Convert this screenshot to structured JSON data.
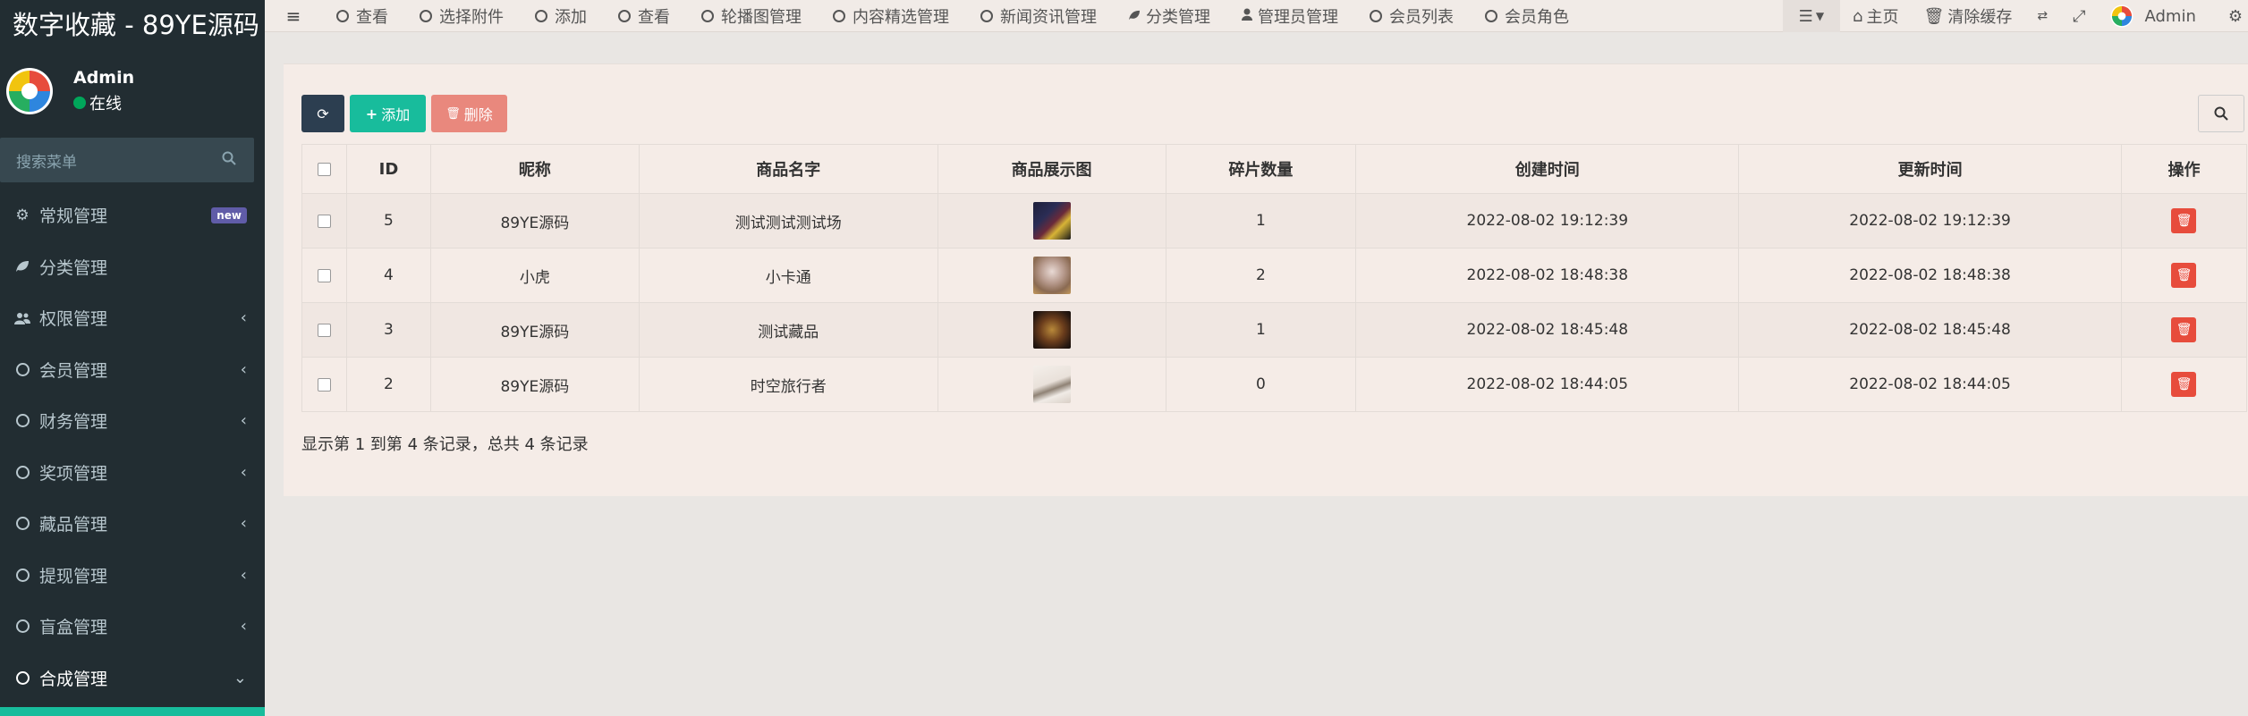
{
  "app_title": "数字收藏 - 89YE源码",
  "user": {
    "name": "Admin",
    "status": "在线"
  },
  "search": {
    "placeholder": "搜索菜单"
  },
  "menu": [
    {
      "label": "常规管理",
      "icon": "cogs-icon",
      "badge": "new"
    },
    {
      "label": "分类管理",
      "icon": "leaf-icon"
    },
    {
      "label": "权限管理",
      "icon": "group-icon",
      "arrow": "‹"
    },
    {
      "label": "会员管理",
      "icon": "circle-o-icon",
      "arrow": "‹"
    },
    {
      "label": "财务管理",
      "icon": "circle-o-icon",
      "arrow": "‹"
    },
    {
      "label": "奖项管理",
      "icon": "circle-o-icon",
      "arrow": "‹"
    },
    {
      "label": "藏品管理",
      "icon": "circle-o-icon",
      "arrow": "‹"
    },
    {
      "label": "提现管理",
      "icon": "circle-o-icon",
      "arrow": "‹"
    },
    {
      "label": "盲盒管理",
      "icon": "circle-o-icon",
      "arrow": "‹"
    },
    {
      "label": "合成管理",
      "icon": "circle-o-icon",
      "arrow": "⌄"
    }
  ],
  "nav_tabs": [
    {
      "label": "查看",
      "icon": "circle-o-icon"
    },
    {
      "label": "选择附件",
      "icon": "circle-o-icon"
    },
    {
      "label": "添加",
      "icon": "circle-o-icon"
    },
    {
      "label": "查看",
      "icon": "circle-o-icon"
    },
    {
      "label": "轮播图管理",
      "icon": "circle-o-icon"
    },
    {
      "label": "内容精选管理",
      "icon": "circle-o-icon"
    },
    {
      "label": "新闻资讯管理",
      "icon": "circle-o-icon"
    },
    {
      "label": "分类管理",
      "icon": "leaf-icon"
    },
    {
      "label": "管理员管理",
      "icon": "user-icon"
    },
    {
      "label": "会员列表",
      "icon": "circle-o-icon"
    },
    {
      "label": "会员角色",
      "icon": "circle-o-icon"
    }
  ],
  "nav_right": {
    "home": "主页",
    "clear_cache": "清除缓存",
    "admin": "Admin"
  },
  "toolbar": {
    "add_label": "添加",
    "delete_label": "删除"
  },
  "table": {
    "headers": [
      "ID",
      "昵称",
      "商品名字",
      "商品展示图",
      "碎片数量",
      "创建时间",
      "更新时间",
      "操作"
    ],
    "rows": [
      {
        "id": "5",
        "nickname": "89YE源码",
        "goods_name": "测试测试测试场",
        "fragments": "1",
        "created": "2022-08-02 19:12:39",
        "updated": "2022-08-02 19:12:39"
      },
      {
        "id": "4",
        "nickname": "小虎",
        "goods_name": "小卡通",
        "fragments": "2",
        "created": "2022-08-02 18:48:38",
        "updated": "2022-08-02 18:48:38"
      },
      {
        "id": "3",
        "nickname": "89YE源码",
        "goods_name": "测试藏品",
        "fragments": "1",
        "created": "2022-08-02 18:45:48",
        "updated": "2022-08-02 18:45:48"
      },
      {
        "id": "2",
        "nickname": "89YE源码",
        "goods_name": "时空旅行者",
        "fragments": "0",
        "created": "2022-08-02 18:44:05",
        "updated": "2022-08-02 18:44:05"
      }
    ]
  },
  "pagination_text": "显示第 1 到第 4 条记录，总共 4 条记录",
  "colors": {
    "sidebar_bg": "#222d32",
    "accent": "#18bc9c",
    "danger": "#e74c3c",
    "primary_dark": "#2c3e50"
  }
}
